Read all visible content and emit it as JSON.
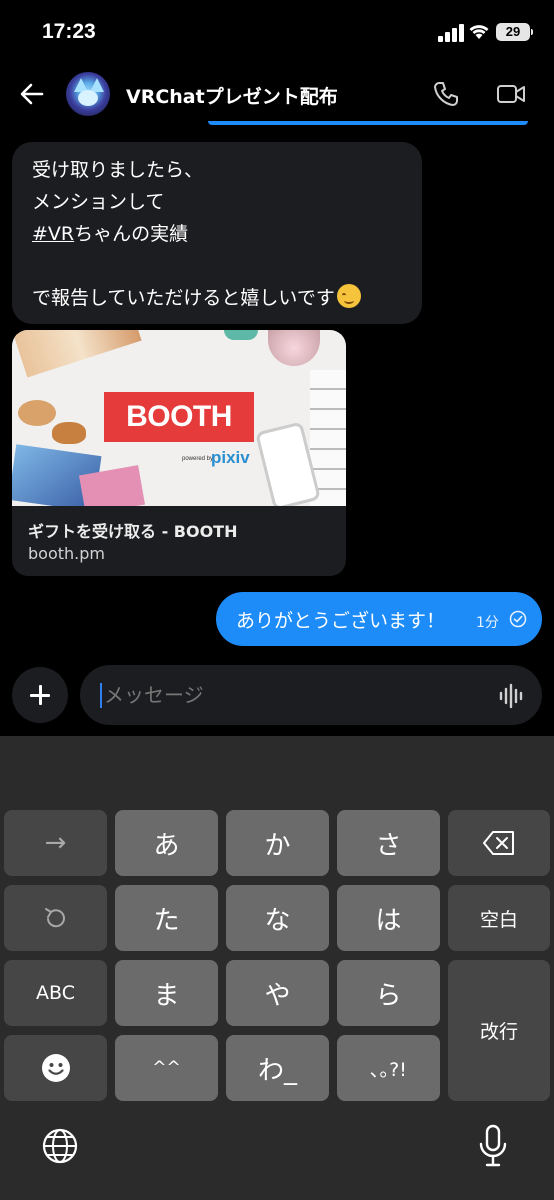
{
  "status_bar": {
    "time": "17:23",
    "battery": "29"
  },
  "header": {
    "title": "VRChatプレゼント配布"
  },
  "messages": {
    "incoming": {
      "line1": "受け取りましたら、",
      "line2": "メンションして",
      "hashtag": "#VR",
      "line3_rest": "ちゃんの実績",
      "line4": "",
      "line5": "で報告していただけると嬉しいです"
    },
    "link_card": {
      "logo": "BOOTH",
      "powered": "powered by",
      "pixiv": "pixiv",
      "title": "ギフトを受け取る - BOOTH",
      "domain": "booth.pm"
    },
    "outgoing": {
      "text": "ありがとうございます！",
      "time": "1分"
    }
  },
  "composer": {
    "placeholder": "メッセージ"
  },
  "keyboard": {
    "row1": [
      "→",
      "あ",
      "か",
      "さ",
      "⌫"
    ],
    "row2": [
      "↺",
      "た",
      "な",
      "は",
      "空白"
    ],
    "row3": [
      "ABC",
      "ま",
      "や",
      "ら"
    ],
    "row4": [
      "☻",
      "^^",
      "わ_",
      "､｡?!"
    ],
    "enter": "改行"
  },
  "colors": {
    "accent": "#1d8cf8",
    "bubble_in": "#1c1d20",
    "booth_red": "#e63b3b"
  }
}
